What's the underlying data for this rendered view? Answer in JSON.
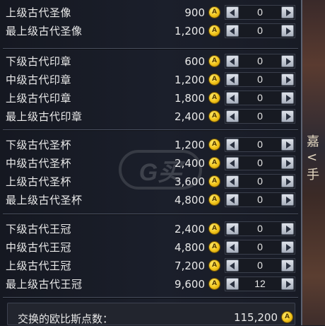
{
  "coin_icon_letter": "A",
  "groups": [
    {
      "items": [
        {
          "name": "上级古代圣像",
          "price": "900",
          "qty": "0"
        },
        {
          "name": "最上级古代圣像",
          "price": "1,200",
          "qty": "0"
        }
      ]
    },
    {
      "items": [
        {
          "name": "下级古代印章",
          "price": "600",
          "qty": "0"
        },
        {
          "name": "中级古代印章",
          "price": "1,200",
          "qty": "0"
        },
        {
          "name": "上级古代印章",
          "price": "1,800",
          "qty": "0"
        },
        {
          "name": "最上级古代印章",
          "price": "2,400",
          "qty": "0"
        }
      ]
    },
    {
      "items": [
        {
          "name": "下级古代圣杯",
          "price": "1,200",
          "qty": "0"
        },
        {
          "name": "中级古代圣杯",
          "price": "2,400",
          "qty": "0"
        },
        {
          "name": "上级古代圣杯",
          "price": "3,600",
          "qty": "0"
        },
        {
          "name": "最上级古代圣杯",
          "price": "4,800",
          "qty": "0"
        }
      ]
    },
    {
      "items": [
        {
          "name": "下级古代王冠",
          "price": "2,400",
          "qty": "0"
        },
        {
          "name": "中级古代王冠",
          "price": "4,800",
          "qty": "0"
        },
        {
          "name": "上级古代王冠",
          "price": "7,200",
          "qty": "0"
        },
        {
          "name": "最上级古代王冠",
          "price": "9,600",
          "qty": "12"
        }
      ]
    }
  ],
  "total": {
    "label": "交换的欧比斯点数：",
    "value": "115,200"
  },
  "watermark_text": "G买",
  "background_glyphs": [
    "嘉",
    "<手"
  ]
}
